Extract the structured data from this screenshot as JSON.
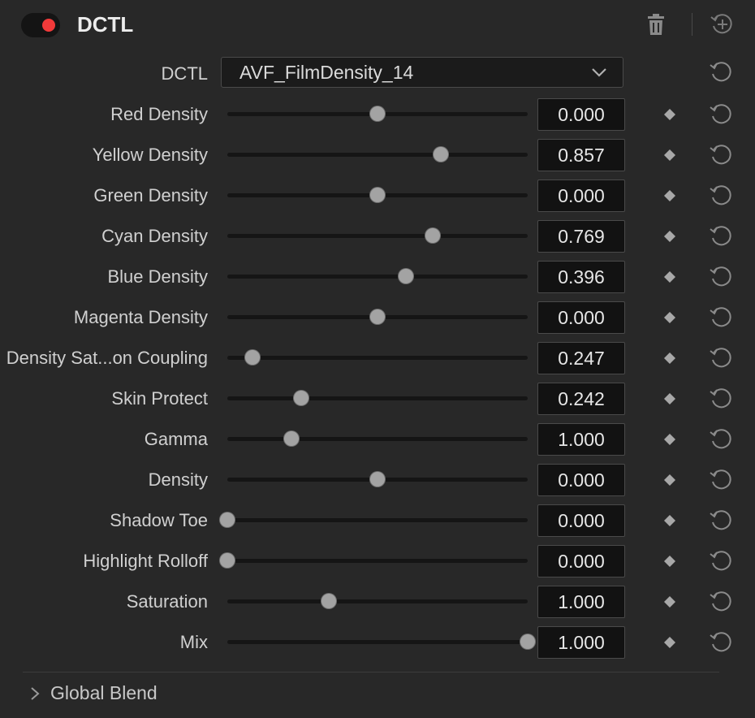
{
  "header": {
    "title": "DCTL",
    "toggle_color": "#f23a3a",
    "enabled": true,
    "icons": [
      "trash-icon",
      "add-node-icon"
    ]
  },
  "dctl": {
    "label": "DCTL",
    "selected": "AVF_FilmDensity_14"
  },
  "params": [
    {
      "label": "Red Density",
      "value": "0.000",
      "position": 0.5
    },
    {
      "label": "Yellow Density",
      "value": "0.857",
      "position": 0.71
    },
    {
      "label": "Green Density",
      "value": "0.000",
      "position": 0.5
    },
    {
      "label": "Cyan Density",
      "value": "0.769",
      "position": 0.685
    },
    {
      "label": "Blue Density",
      "value": "0.396",
      "position": 0.595
    },
    {
      "label": "Magenta Density",
      "value": "0.000",
      "position": 0.5
    },
    {
      "label": "Density Sat...on Coupling",
      "value": "0.247",
      "position": 0.083
    },
    {
      "label": "Skin Protect",
      "value": "0.242",
      "position": 0.245
    },
    {
      "label": "Gamma",
      "value": "1.000",
      "position": 0.213
    },
    {
      "label": "Density",
      "value": "0.000",
      "position": 0.5
    },
    {
      "label": "Shadow Toe",
      "value": "0.000",
      "position": 0.0
    },
    {
      "label": "Highlight Rolloff",
      "value": "0.000",
      "position": 0.0
    },
    {
      "label": "Saturation",
      "value": "1.000",
      "position": 0.338
    },
    {
      "label": "Mix",
      "value": "1.000",
      "position": 1.0
    }
  ],
  "global_blend": {
    "label": "Global Blend",
    "expanded": false
  }
}
